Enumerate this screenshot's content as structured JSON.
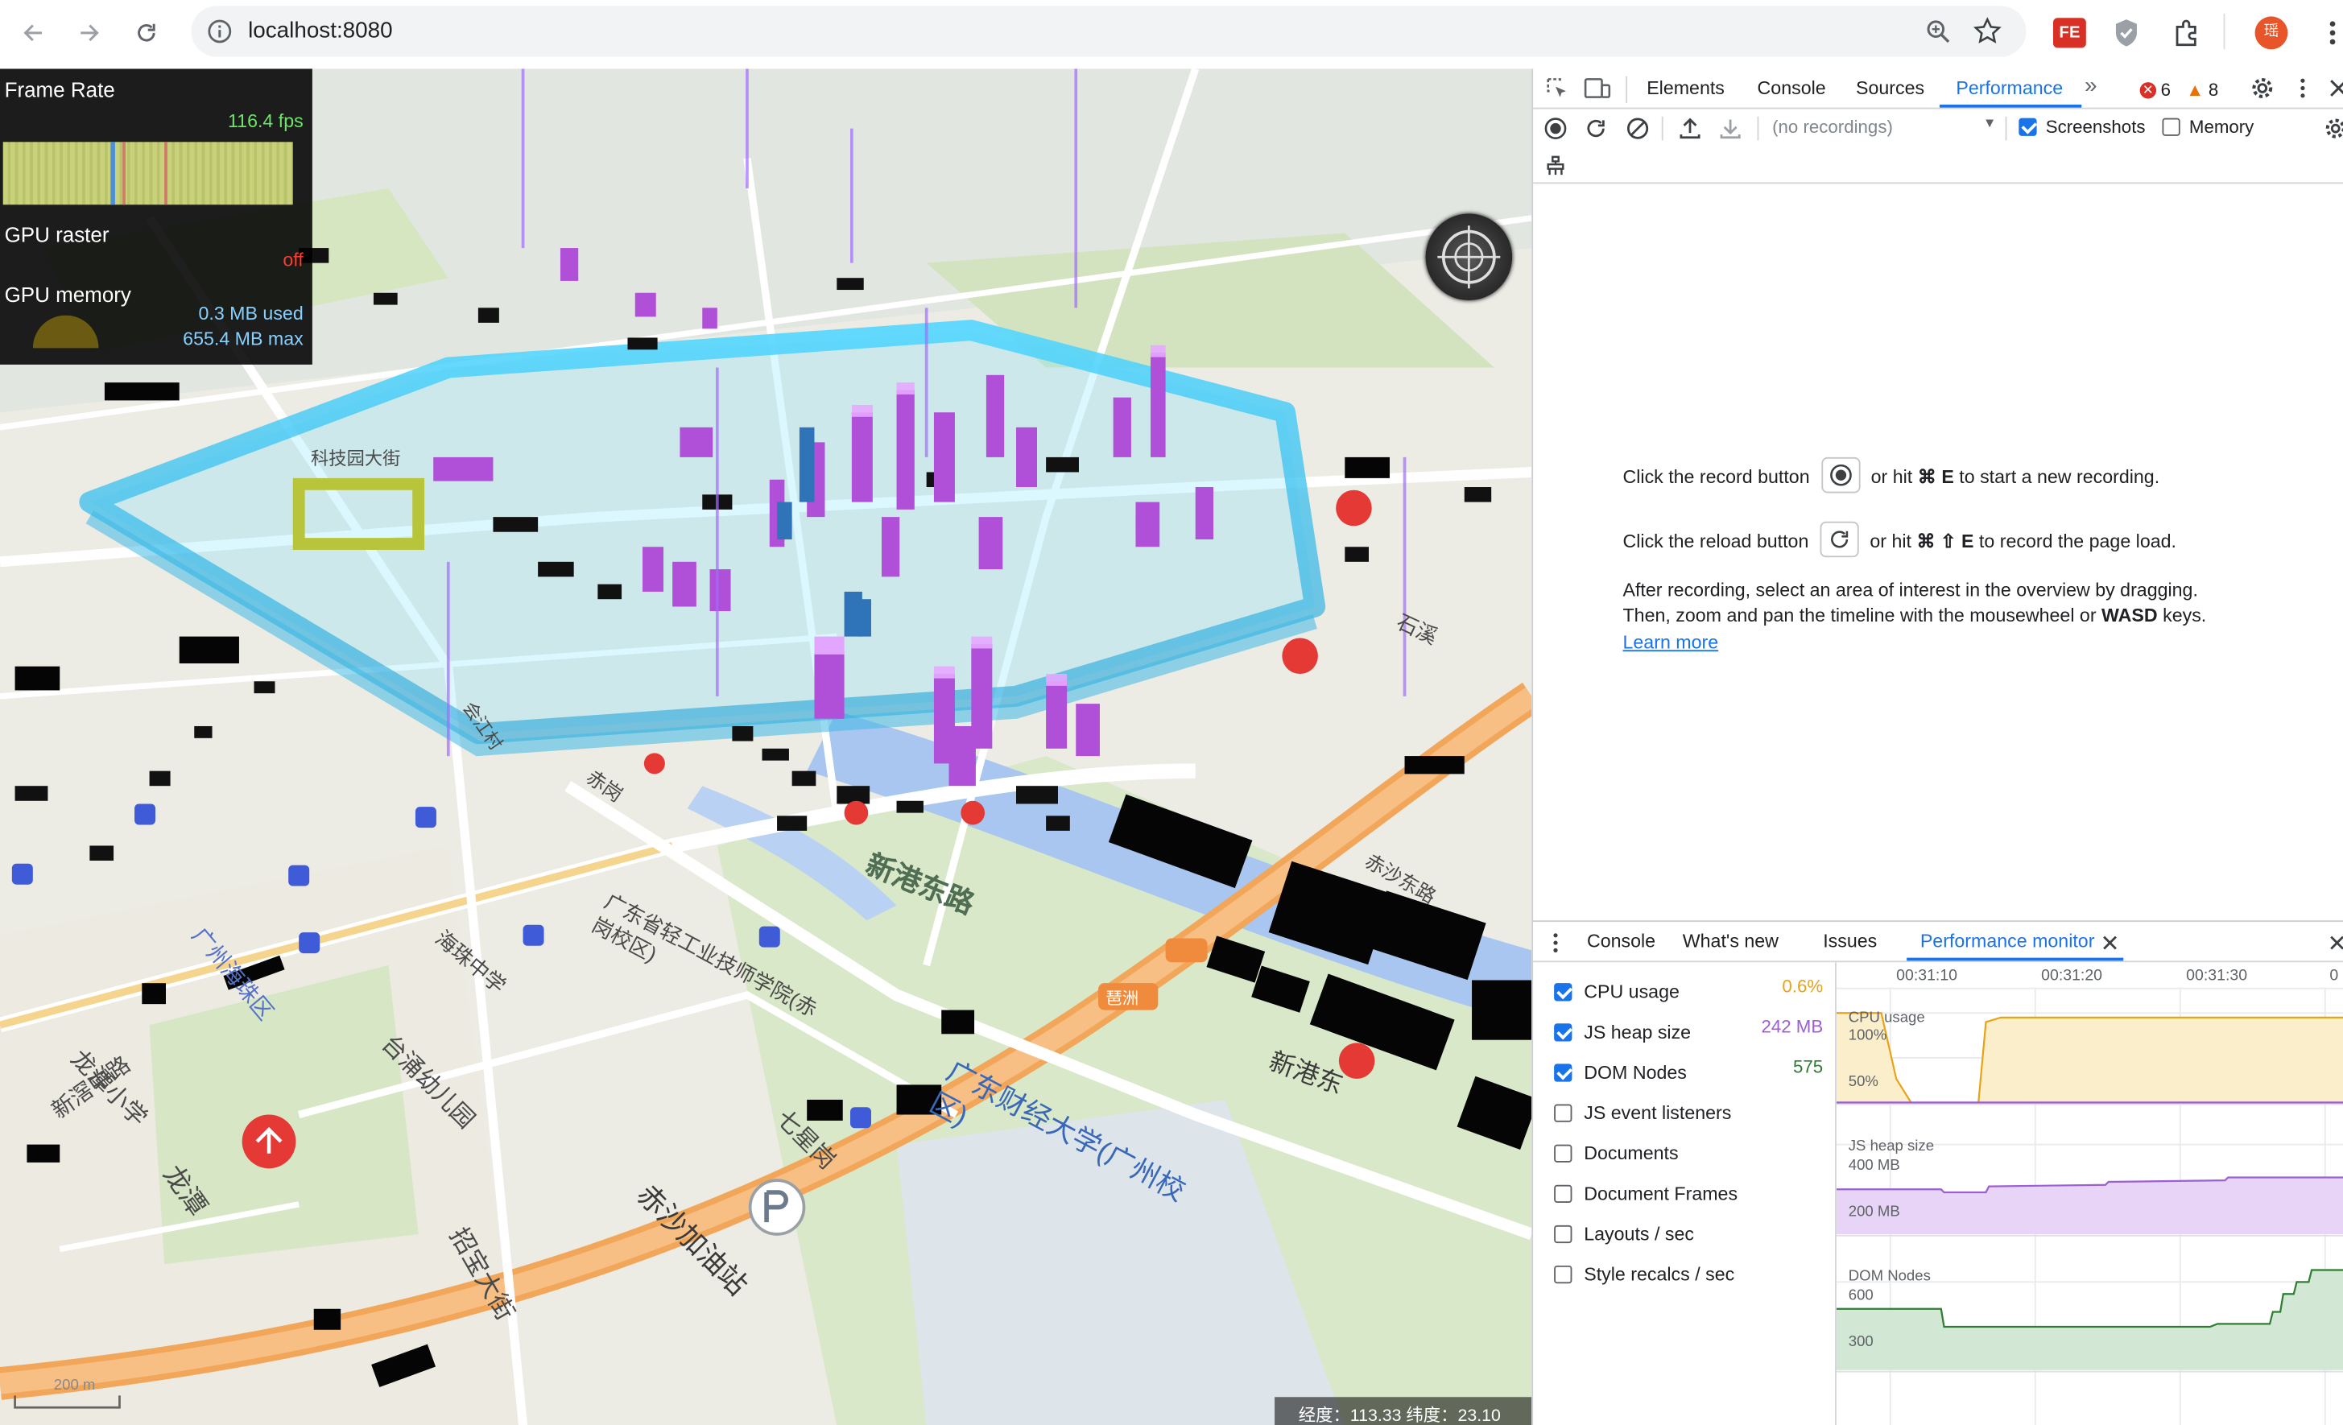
{
  "browser": {
    "url": "localhost:8080",
    "extension_label": "FE",
    "profile_initial": "瑶"
  },
  "stats": {
    "frame_rate_label": "Frame Rate",
    "fps": "116.4 fps",
    "gpu_raster_label": "GPU raster",
    "gpu_raster_value": "off",
    "gpu_memory_label": "GPU memory",
    "gpu_memory_used": "0.3 MB used",
    "gpu_memory_max": "655.4 MB max"
  },
  "map": {
    "coord_readout": "经度：113.33  纬度：23.10",
    "scale_label": "200 m",
    "labels": {
      "l1": "科技园大街",
      "l2": "新港东路",
      "l3": "广东省轻工业技师学院(赤岗校区)",
      "l4": "海珠中学",
      "l5": "台涌幼儿园",
      "l6": "七星岗",
      "l7": "广东财经大学(广州校区)",
      "l8": "赤沙加油站",
      "l9": "新港东",
      "l10": "琶洲",
      "l11": "龙潭小学",
      "l12": "赤岗",
      "l13": "广州海珠区",
      "l14": "石溪",
      "l15": "会江村",
      "l16": "赤沙东路",
      "l17": "新滘中路",
      "l18": "龙潭",
      "l19": "招宝大街"
    }
  },
  "devtools": {
    "tabs": [
      "Elements",
      "Console",
      "Sources",
      "Performance"
    ],
    "errors": "6",
    "warnings": "8",
    "recordings_placeholder": "(no recordings)",
    "screenshots_label": "Screenshots",
    "memory_label": "Memory",
    "landing": {
      "line1_a": "Click the record button",
      "line1_b": "or hit",
      "line1_key": "⌘ E",
      "line1_c": "to start a new recording.",
      "line2_a": "Click the reload button",
      "line2_b": "or hit",
      "line2_key": "⌘ ⇧ E",
      "line2_c": "to record the page load.",
      "line3": "After recording, select an area of interest in the overview by dragging.",
      "line4_a": "Then, zoom and pan the timeline with the mousewheel or",
      "line4_key": "WASD",
      "line4_b": "keys.",
      "learn_more": "Learn more"
    },
    "drawer_tabs": [
      "Console",
      "What's new",
      "Issues",
      "Performance monitor"
    ],
    "metrics": [
      {
        "label": "CPU usage",
        "checked": true,
        "value": "0.6%",
        "color": "#e8a317"
      },
      {
        "label": "JS heap size",
        "checked": true,
        "value": "242 MB",
        "color": "#9c5fd4"
      },
      {
        "label": "DOM Nodes",
        "checked": true,
        "value": "575",
        "color": "#2e7d32"
      },
      {
        "label": "JS event listeners",
        "checked": false,
        "value": "",
        "color": ""
      },
      {
        "label": "Documents",
        "checked": false,
        "value": "",
        "color": ""
      },
      {
        "label": "Document Frames",
        "checked": false,
        "value": "",
        "color": ""
      },
      {
        "label": "Layouts / sec",
        "checked": false,
        "value": "",
        "color": ""
      },
      {
        "label": "Style recalcs / sec",
        "checked": false,
        "value": "",
        "color": ""
      }
    ],
    "timeline_ticks": [
      "00:31:10",
      "00:31:20",
      "00:31:30"
    ],
    "graphs": {
      "cpu_label": "CPU usage",
      "cpu_100": "100%",
      "cpu_50": "50%",
      "heap_label": "JS heap size",
      "heap_400": "400 MB",
      "heap_200": "200 MB",
      "dom_label": "DOM Nodes",
      "dom_600": "600",
      "dom_300": "300"
    }
  }
}
